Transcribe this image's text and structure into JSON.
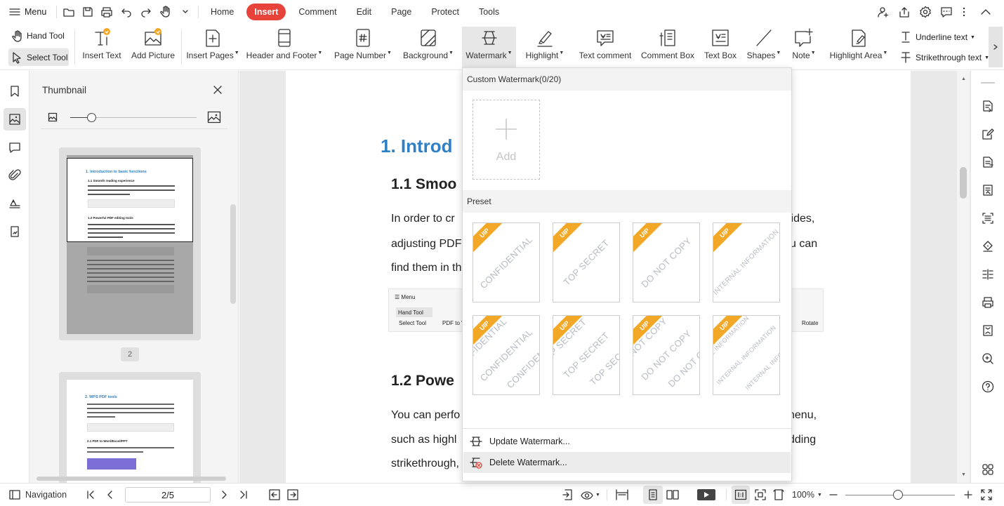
{
  "topbar": {
    "menu_label": "Menu",
    "tabs": [
      {
        "label": "Home"
      },
      {
        "label": "Insert"
      },
      {
        "label": "Comment"
      },
      {
        "label": "Edit"
      },
      {
        "label": "Page"
      },
      {
        "label": "Protect"
      },
      {
        "label": "Tools"
      }
    ],
    "active_tab": "Insert"
  },
  "ribbon": {
    "hand_tool": "Hand Tool",
    "select_tool": "Select Tool",
    "insert_text": "Insert Text",
    "add_picture": "Add Picture",
    "insert_pages": "Insert Pages",
    "header_footer": "Header and Footer",
    "page_number": "Page Number",
    "background": "Background",
    "watermark": "Watermark",
    "highlight": "Highlight",
    "text_comment": "Text comment",
    "comment_box": "Comment Box",
    "text_box": "Text Box",
    "shapes": "Shapes",
    "note": "Note",
    "highlight_area": "Highlight Area",
    "underline_text": "Underline text",
    "strikethrough_text": "Strikethrough text"
  },
  "thumbnail": {
    "title": "Thumbnail",
    "page_badge": "2",
    "thumb1": {
      "h1": "1. Introduction to basic functions",
      "h2a": "1.1 Smooth reading experience",
      "h2b": "1.2 Powerful PDF editing tools"
    },
    "thumb2": {
      "h1": "2.  WPS PDF tools",
      "h2": "2.1 PDF to Word/Excel/PPT"
    }
  },
  "document": {
    "heading1": "1. Introd",
    "heading11": "1.1 Smoo",
    "para1": [
      "In order to cr",
      "adjusting PDF",
      "find them in th"
    ],
    "para1_right": [
      "lides,",
      "u can"
    ],
    "heading12": "1.2 Powe",
    "para2": [
      "You can perfo",
      "such as highl",
      "strikethrough,"
    ],
    "para2_right": [
      "nenu,",
      "dding"
    ],
    "embed": {
      "menu": "Menu",
      "hand_tool": "Hand Tool",
      "select_tool": "Select Tool",
      "pdf_to": "PDF to V",
      "rotate": "Rotate",
      "e": "e"
    }
  },
  "watermark_menu": {
    "custom_header": "Custom Watermark(0/20)",
    "add_label": "Add",
    "preset_header": "Preset",
    "badge": "UIP",
    "presets_single": [
      "CONFIDENTIAL",
      "TOP SECRET",
      "DO NOT COPY",
      "INTERNAL INFORMATION"
    ],
    "presets_tiled": [
      [
        "FIDENTIAL",
        "CONFIDENTIAL",
        "CONFIDEN"
      ],
      [
        "P SECRET",
        "TOP SECRET",
        "TOP SEC"
      ],
      [
        "NOT COPY",
        "DO NOT COPY",
        "DO NOT C"
      ],
      [
        "AL INFORMATION",
        "INTERNAL INFORMATION",
        "INTERNAL INFOR"
      ]
    ],
    "update_label": "Update Watermark...",
    "delete_label": "Delete Watermark..."
  },
  "statusbar": {
    "navigation": "Navigation",
    "page_value": "2/5",
    "zoom": "100%"
  },
  "colors": {
    "accent": "#e8433a",
    "heading_blue": "#2f7fc4",
    "badge_orange": "#f2a826",
    "selected_bg": "#e7e7e7"
  }
}
